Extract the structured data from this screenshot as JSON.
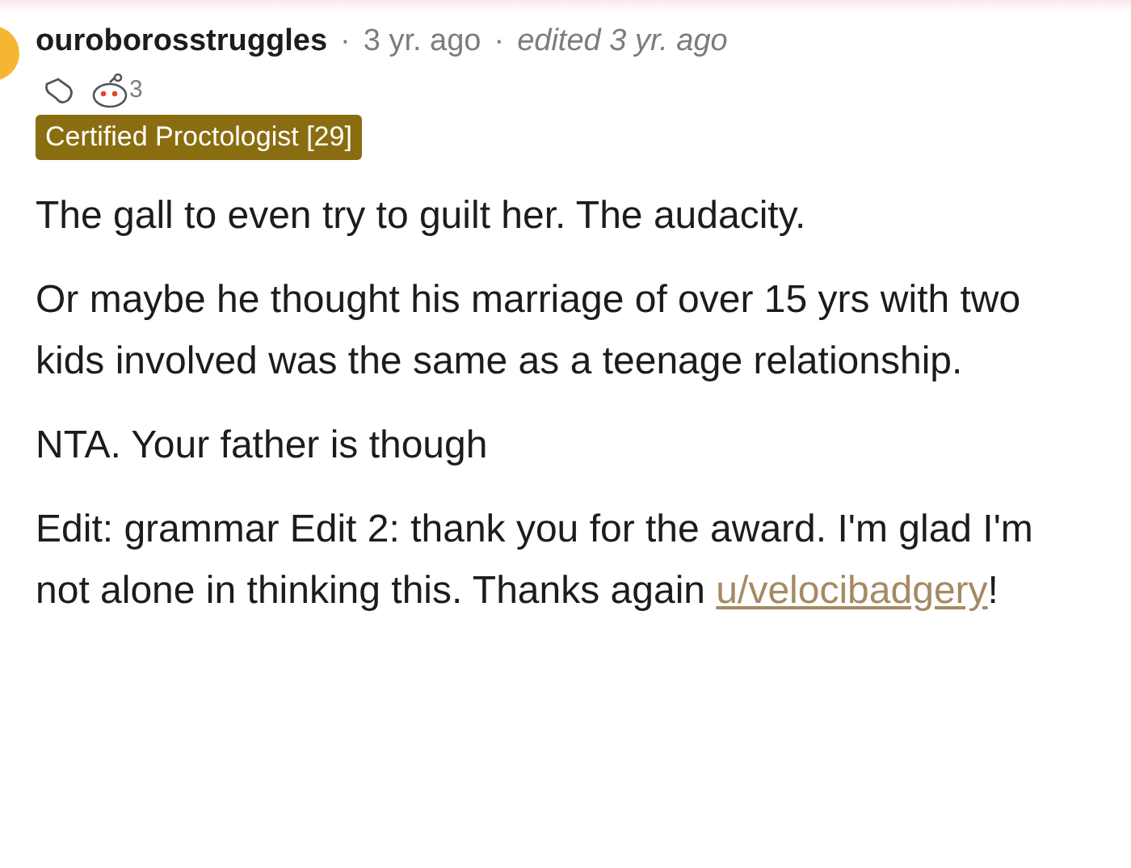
{
  "comment": {
    "author": "ouroborosstruggles",
    "sep1": "·",
    "time": "3 yr. ago",
    "sep2": "·",
    "edited": "edited 3 yr. ago",
    "award_count": "3",
    "flair": "Certified Proctologist [29]",
    "paragraphs": [
      {
        "text": "The gall to even try to guilt her. The audacity."
      },
      {
        "text": "Or maybe he thought his marriage of over 15 yrs with two kids involved was the same as a teenage relationship."
      },
      {
        "text": "NTA. Your father is though"
      },
      {
        "text": "Edit: grammar Edit 2: thank you for the award. I'm glad I'm not alone in thinking this. Thanks again ",
        "link": "u/velocibadgery",
        "after": "!"
      }
    ]
  }
}
